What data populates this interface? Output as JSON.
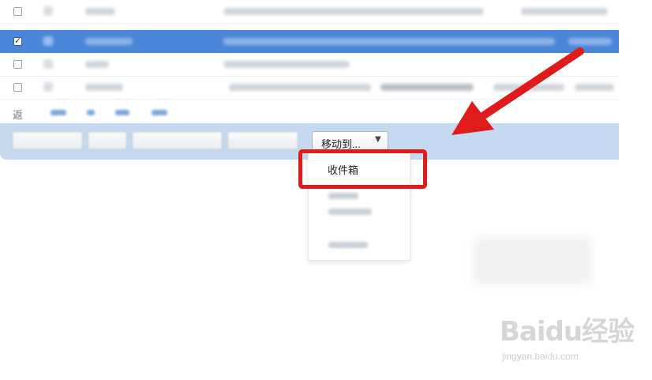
{
  "toolbar": {
    "move_to_label": "移动到...",
    "move_to_caret": "▼"
  },
  "move_menu": {
    "items": [
      {
        "label": "收件箱"
      }
    ]
  },
  "pager": {
    "prefix": "返"
  },
  "annotation": {
    "arrow_color": "#e01b1b",
    "box_color": "#e01b1b"
  },
  "watermark": {
    "logo": "Baidu经验",
    "url": "jingyan.baidu.com"
  },
  "colors": {
    "selected_row": "#4a86d8",
    "toolbar_bg": "#c5d9f1"
  }
}
